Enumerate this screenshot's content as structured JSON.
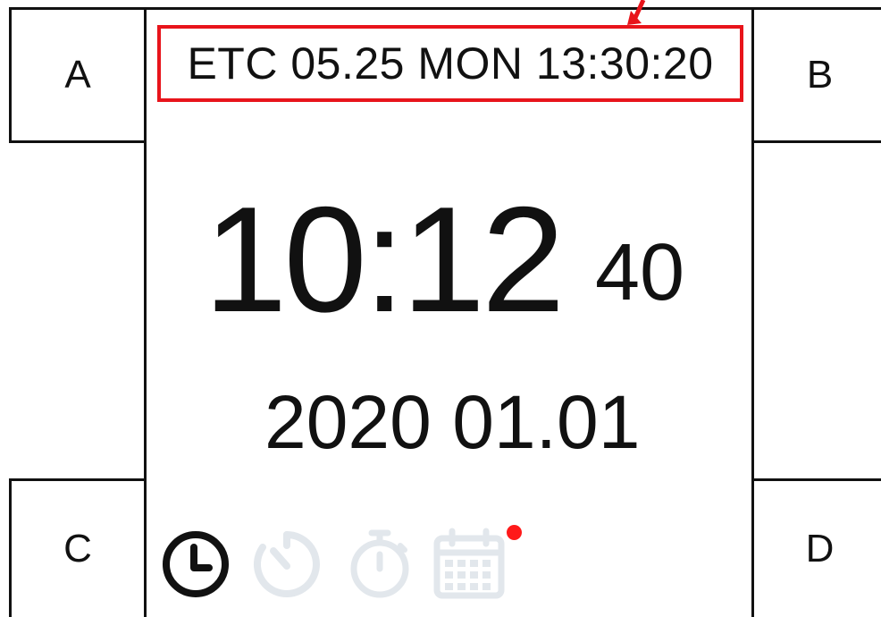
{
  "header": {
    "status_text": "ETC 05.25 MON 13:30:20",
    "highlight_color": "#e8141b"
  },
  "buttons": {
    "a": "A",
    "b": "B",
    "c": "C",
    "d": "D"
  },
  "clock": {
    "time": "10:12",
    "seconds": "40",
    "date": "2020 01.01"
  },
  "tabs": [
    {
      "icon": "clock-icon",
      "active": true
    },
    {
      "icon": "timer-icon",
      "active": false
    },
    {
      "icon": "stopwatch-icon",
      "active": false
    },
    {
      "icon": "calendar-icon",
      "active": false,
      "badge": true
    }
  ],
  "colors": {
    "active_icon": "#111111",
    "inactive_icon": "#e2e7ec",
    "badge": "#ff1a1a"
  }
}
